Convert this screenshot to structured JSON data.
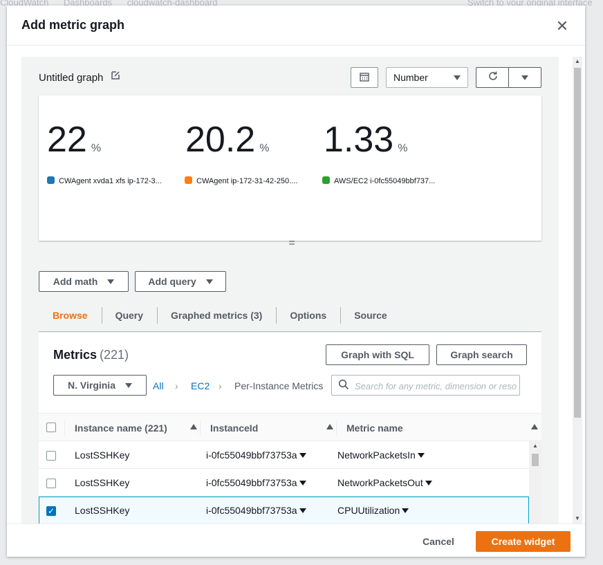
{
  "background": {
    "breadcrumbs": [
      "CloudWatch",
      "Dashboards",
      "cloudwatch-dashboard"
    ],
    "right_link": "Switch to your original interface"
  },
  "modal": {
    "title": "Add metric graph",
    "graph_title": "Untitled graph",
    "display_type": "Number",
    "stats": [
      {
        "value": "22",
        "unit": "%",
        "legend": "CWAgent xvda1 xfs ip-172-3...",
        "color": "#1f77b4"
      },
      {
        "value": "20.2",
        "unit": "%",
        "legend": "CWAgent ip-172-31-42-250....",
        "color": "#ff7f0e"
      },
      {
        "value": "1.33",
        "unit": "%",
        "legend": "AWS/EC2 i-0fc55049bbf737...",
        "color": "#2ca02c"
      }
    ],
    "add_math": "Add math",
    "add_query": "Add query",
    "tabs": [
      "Browse",
      "Query",
      "Graphed metrics (3)",
      "Options",
      "Source"
    ],
    "active_tab": "Browse",
    "metrics": {
      "title": "Metrics",
      "count": "(221)",
      "graph_with_sql": "Graph with SQL",
      "graph_search": "Graph search",
      "region": "N. Virginia",
      "crumbs": {
        "all": "All",
        "ec2": "EC2",
        "current": "Per-Instance Metrics"
      },
      "search_placeholder": "Search for any metric, dimension or resource id",
      "columns": [
        "Instance name (221)",
        "InstanceId",
        "Metric name"
      ],
      "rows": [
        {
          "name": "LostSSHKey",
          "instance_id": "i-0fc55049bbf73753a",
          "metric": "NetworkPacketsIn",
          "checked": false
        },
        {
          "name": "LostSSHKey",
          "instance_id": "i-0fc55049bbf73753a",
          "metric": "NetworkPacketsOut",
          "checked": false
        },
        {
          "name": "LostSSHKey",
          "instance_id": "i-0fc55049bbf73753a",
          "metric": "CPUUtilization",
          "checked": true
        }
      ]
    },
    "cancel": "Cancel",
    "create": "Create widget"
  }
}
